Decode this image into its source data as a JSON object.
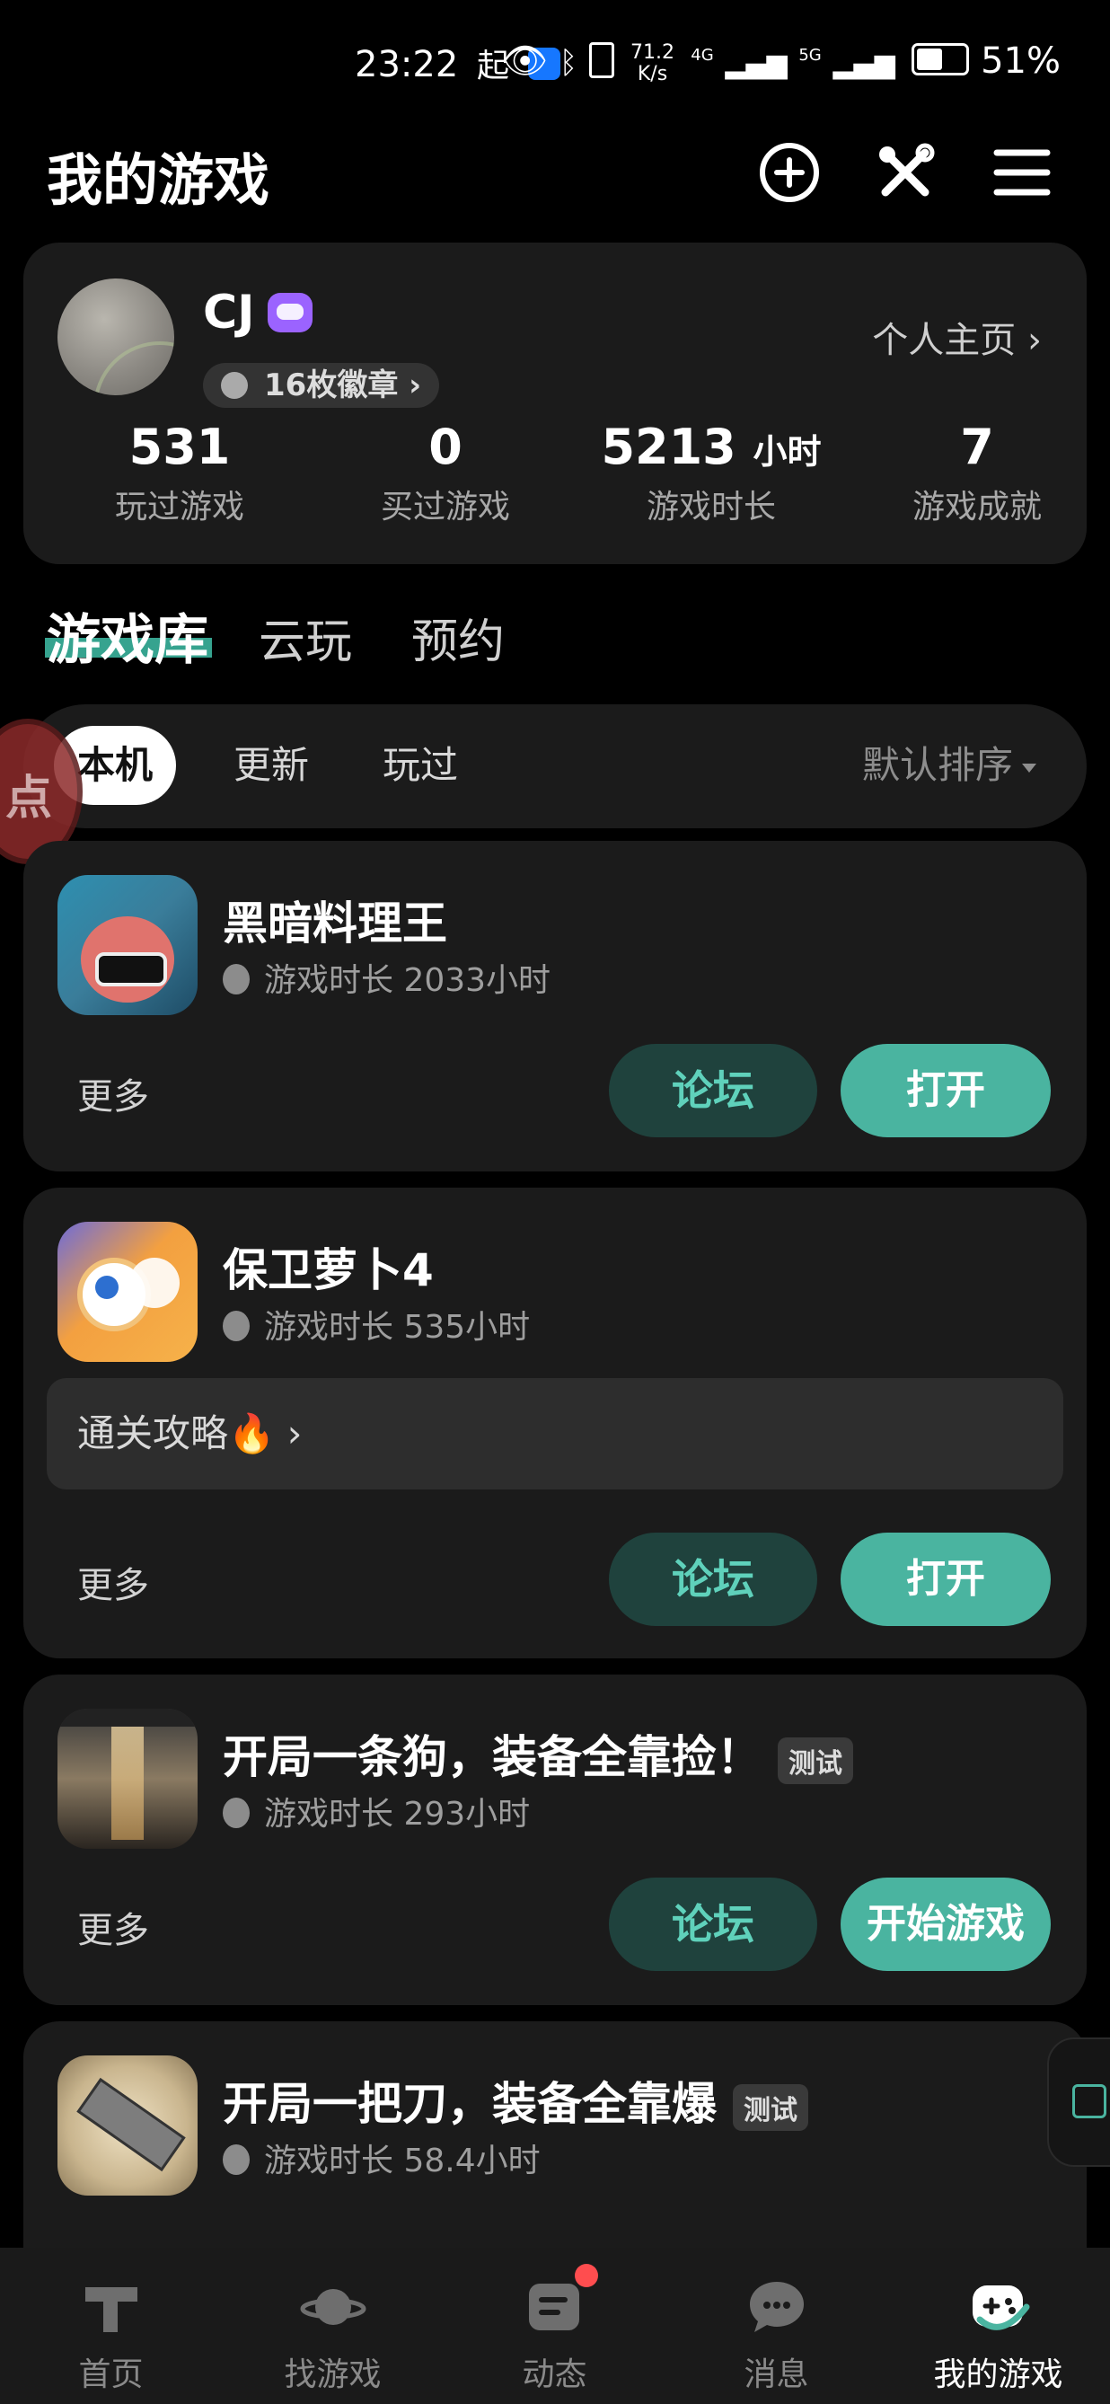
{
  "status_bar": {
    "time": "23:22",
    "extra_left": "起",
    "net_speed": "71.2 K/s",
    "signal_a": "4G",
    "signal_b": "5G",
    "battery": "51%"
  },
  "header": {
    "title": "我的游戏",
    "icons": [
      "add-circle-icon",
      "tools-icon",
      "menu-icon"
    ]
  },
  "profile": {
    "name": "CJ",
    "badge_text": "16枚徽章",
    "homepage_link": "个人主页",
    "stats": [
      {
        "value": "531",
        "unit": "",
        "label": "玩过游戏"
      },
      {
        "value": "0",
        "unit": "",
        "label": "买过游戏"
      },
      {
        "value": "5213",
        "unit": "小时",
        "label": "游戏时长"
      },
      {
        "value": "7",
        "unit": "",
        "label": "游戏成就"
      }
    ]
  },
  "main_tabs": [
    {
      "label": "游戏库",
      "active": true
    },
    {
      "label": "云玩",
      "active": false
    },
    {
      "label": "预约",
      "active": false
    }
  ],
  "filters": {
    "chips": [
      {
        "label": "本机",
        "active": true
      },
      {
        "label": "更新",
        "active": false
      },
      {
        "label": "玩过",
        "active": false
      }
    ],
    "sort_label": "默认排序"
  },
  "floating_ball_text": "点",
  "games": [
    {
      "name": "黑暗料理王",
      "tag": "",
      "time": "游戏时长 2033小时",
      "guide": "",
      "more": "更多",
      "forum": "论坛",
      "action": "打开"
    },
    {
      "name": "保卫萝卜4",
      "tag": "",
      "time": "游戏时长 535小时",
      "guide": "通关攻略🔥 ›",
      "more": "更多",
      "forum": "论坛",
      "action": "打开"
    },
    {
      "name": "开局一条狗，装备全靠捡！",
      "tag": "测试",
      "time": "游戏时长 293小时",
      "guide": "",
      "more": "更多",
      "forum": "论坛",
      "action": "开始游戏"
    },
    {
      "name": "开局一把刀，装备全靠爆",
      "tag": "测试",
      "time": "游戏时长 58.4小时",
      "guide": "",
      "more": "",
      "forum": "",
      "action": ""
    }
  ],
  "bottom_nav": [
    {
      "label": "首页",
      "icon": "home-icon",
      "active": false
    },
    {
      "label": "找游戏",
      "icon": "planet-icon",
      "active": false
    },
    {
      "label": "动态",
      "icon": "feed-icon",
      "active": false,
      "notification": true
    },
    {
      "label": "消息",
      "icon": "chat-icon",
      "active": false
    },
    {
      "label": "我的游戏",
      "icon": "gamepad-icon",
      "active": true
    }
  ],
  "colors": {
    "accent": "#4ab4a0",
    "accent_dark": "#1f423d",
    "card_bg": "#1b1b1b",
    "page_bg": "#000000"
  }
}
